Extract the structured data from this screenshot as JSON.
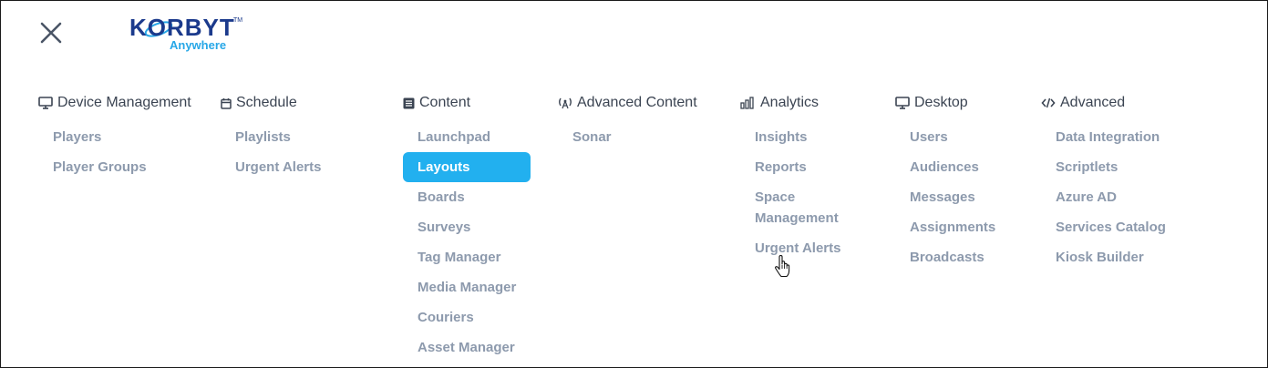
{
  "logo": {
    "brand": "KORBYT",
    "tagline": "Anywhere",
    "brand_color": "#1b3a8c",
    "accent_color": "#27a7e7"
  },
  "colors": {
    "header_text": "#3b4452",
    "item_text": "#8d9aad",
    "active_bg": "#22b0ef",
    "active_text": "#ffffff"
  },
  "columns": [
    {
      "id": "device-management",
      "icon": "monitor-icon",
      "title": "Device Management",
      "items": [
        {
          "label": "Players"
        },
        {
          "label": "Player Groups"
        }
      ]
    },
    {
      "id": "schedule",
      "icon": "calendar-icon",
      "title": "Schedule",
      "items": [
        {
          "label": "Playlists"
        },
        {
          "label": "Urgent Alerts"
        }
      ]
    },
    {
      "id": "content",
      "icon": "content-icon",
      "title": "Content",
      "items": [
        {
          "label": "Launchpad"
        },
        {
          "label": "Layouts",
          "active": true
        },
        {
          "label": "Boards"
        },
        {
          "label": "Surveys"
        },
        {
          "label": "Tag Manager"
        },
        {
          "label": "Media Manager"
        },
        {
          "label": "Couriers"
        },
        {
          "label": "Asset Manager"
        }
      ]
    },
    {
      "id": "advanced-content",
      "icon": "broadcast-icon",
      "title": "Advanced Content",
      "items": [
        {
          "label": "Sonar"
        }
      ]
    },
    {
      "id": "analytics",
      "icon": "bar-chart-icon",
      "title": "Analytics",
      "items": [
        {
          "label": "Insights"
        },
        {
          "label": "Reports"
        },
        {
          "label": "Space Management"
        },
        {
          "label": "Urgent Alerts"
        }
      ]
    },
    {
      "id": "desktop",
      "icon": "monitor-icon",
      "title": "Desktop",
      "items": [
        {
          "label": "Users"
        },
        {
          "label": "Audiences"
        },
        {
          "label": "Messages"
        },
        {
          "label": "Assignments"
        },
        {
          "label": "Broadcasts"
        }
      ]
    },
    {
      "id": "advanced",
      "icon": "code-icon",
      "title": "Advanced",
      "items": [
        {
          "label": "Data Integration"
        },
        {
          "label": "Scriptlets"
        },
        {
          "label": "Azure AD"
        },
        {
          "label": "Services Catalog"
        },
        {
          "label": "Kiosk Builder"
        }
      ]
    }
  ]
}
